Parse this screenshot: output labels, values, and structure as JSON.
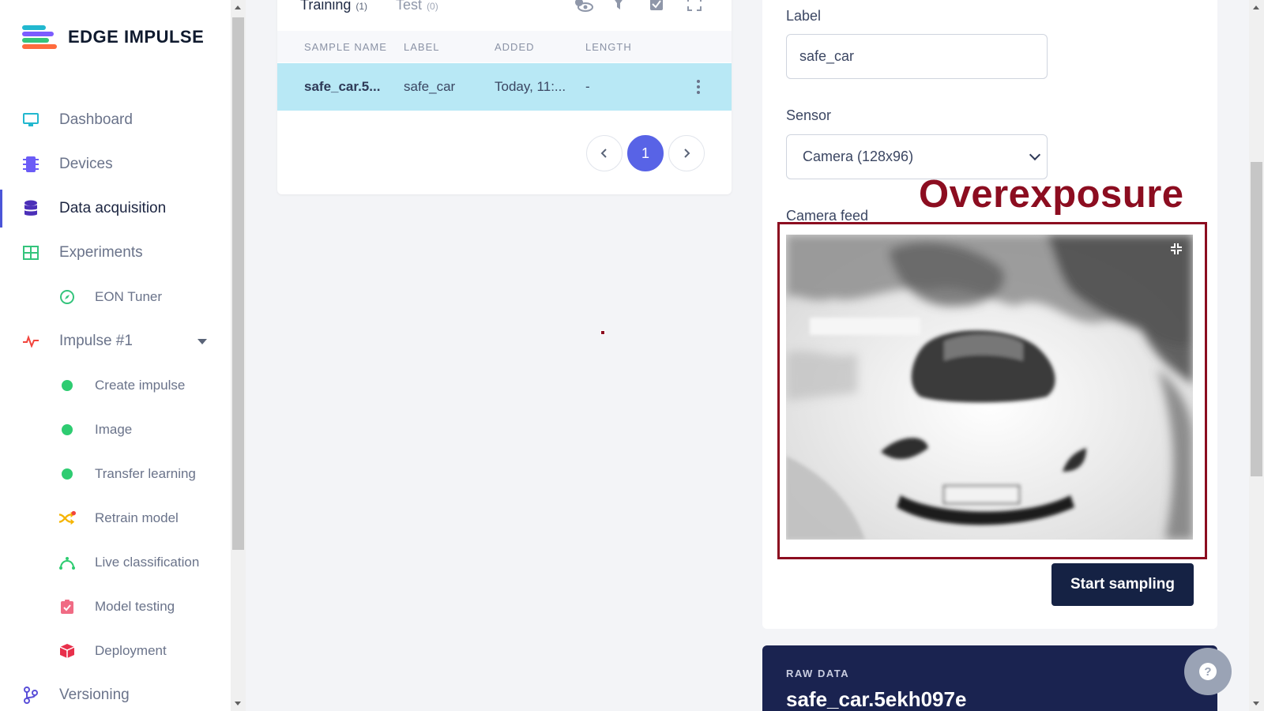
{
  "brand": {
    "name": "EDGE IMPULSE"
  },
  "sidebar": {
    "items": [
      {
        "label": "Dashboard",
        "icon": "monitor-icon"
      },
      {
        "label": "Devices",
        "icon": "chip-icon"
      },
      {
        "label": "Data acquisition",
        "icon": "database-icon",
        "active": true
      },
      {
        "label": "Experiments",
        "icon": "table-icon"
      },
      {
        "label": "EON Tuner",
        "icon": "compass-icon"
      },
      {
        "label": "Impulse #1",
        "icon": "pulse-icon"
      },
      {
        "label": "Create impulse",
        "icon": "green-dot-icon"
      },
      {
        "label": "Image",
        "icon": "green-dot-icon"
      },
      {
        "label": "Transfer learning",
        "icon": "green-dot-icon"
      },
      {
        "label": "Retrain model",
        "icon": "shuffle-icon"
      },
      {
        "label": "Live classification",
        "icon": "bezier-icon"
      },
      {
        "label": "Model testing",
        "icon": "clipboard-check-icon"
      },
      {
        "label": "Deployment",
        "icon": "cube-icon"
      },
      {
        "label": "Versioning",
        "icon": "branch-icon"
      }
    ]
  },
  "dataset": {
    "tabs": [
      {
        "label": "Training",
        "count": "(1)"
      },
      {
        "label": "Test",
        "count": "(0)"
      }
    ],
    "columns": [
      "SAMPLE NAME",
      "LABEL",
      "ADDED",
      "LENGTH"
    ],
    "rows": [
      {
        "name": "safe_car.5...",
        "label": "safe_car",
        "added": "Today, 11:...",
        "length": "-"
      }
    ],
    "pagination": {
      "current": "1"
    }
  },
  "form": {
    "label_title": "Label",
    "label_value": "safe_car",
    "sensor_title": "Sensor",
    "sensor_value": "Camera (128x96)",
    "camera_title": "Camera feed",
    "start_button": "Start sampling"
  },
  "annotation": {
    "text": "Overexposure",
    "color": "#8c0d20"
  },
  "raw_data": {
    "title": "RAW DATA",
    "name": "safe_car.5ekh097e"
  },
  "colors": {
    "accent": "#5863e6",
    "selected_row": "#b8e8f5",
    "primary_button": "#152244"
  }
}
